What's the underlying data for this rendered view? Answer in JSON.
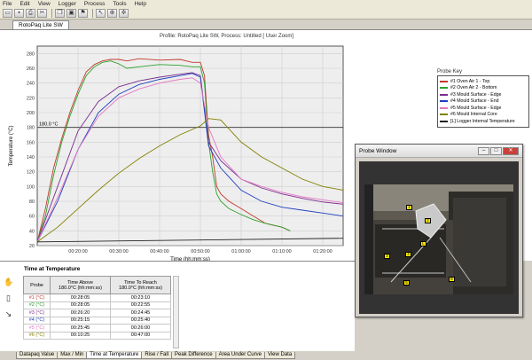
{
  "menu": [
    "File",
    "Edit",
    "View",
    "Logger",
    "Process",
    "Tools",
    "Help"
  ],
  "toolbar_icons": [
    "open-icon",
    "save-icon",
    "print-icon",
    "cut-icon",
    "copy-icon",
    "monitor-icon",
    "flag-icon",
    "cursor-icon",
    "zoom-icon",
    "settings-icon"
  ],
  "document_tab": "RotoPaq Lite SW",
  "chart_title": "Profile: RotoPaq Lite SW, Process: Untitled [ User Zoom]",
  "chart_data": {
    "type": "line",
    "xlabel": "Time (hh:mm:ss)",
    "ylabel": "Temperature (°C)",
    "x_ticks": [
      "00:20:00",
      "00:30:00",
      "00:40:00",
      "00:50:00",
      "01:00:00",
      "01:10:00",
      "01:20:00"
    ],
    "y_ticks": [
      "20",
      "40",
      "60",
      "80",
      "100",
      "120",
      "140",
      "160",
      "180",
      "200",
      "220",
      "240",
      "260",
      "280"
    ],
    "xlim_minutes": [
      10,
      85
    ],
    "ylim": [
      20,
      290
    ],
    "reference_line": {
      "label": "180.0 °C",
      "value": 180
    },
    "series": [
      {
        "name": "#1 Oven Air 1 - Top",
        "color": "#c0392b",
        "x": [
          10,
          12,
          14,
          16,
          18,
          20,
          22,
          24,
          26,
          28,
          30,
          32,
          35,
          40,
          45,
          48,
          50,
          51,
          52,
          53,
          54,
          55,
          57,
          60,
          63,
          66,
          70,
          72
        ],
        "y": [
          25,
          70,
          125,
          165,
          200,
          230,
          255,
          265,
          270,
          272,
          272,
          270,
          273,
          271,
          272,
          268,
          268,
          250,
          170,
          140,
          100,
          90,
          80,
          70,
          60,
          50,
          45,
          40
        ]
      },
      {
        "name": "#2 Oven Air 2 - Bottom",
        "color": "#2ca02c",
        "x": [
          10,
          12,
          14,
          16,
          18,
          20,
          22,
          24,
          26,
          28,
          30,
          32,
          35,
          40,
          45,
          48,
          50,
          51,
          52,
          53,
          54,
          55,
          57,
          60,
          63,
          66,
          70,
          72
        ],
        "y": [
          25,
          60,
          115,
          160,
          195,
          225,
          250,
          262,
          268,
          270,
          266,
          260,
          262,
          265,
          264,
          262,
          262,
          240,
          160,
          120,
          90,
          80,
          70,
          62,
          55,
          50,
          45,
          40
        ]
      },
      {
        "name": "#3 Mould Surface - Edge",
        "color": "#7b2d8e",
        "x": [
          10,
          15,
          20,
          25,
          30,
          35,
          40,
          45,
          48,
          50,
          52,
          55,
          60,
          65,
          70,
          75,
          80,
          85
        ],
        "y": [
          25,
          100,
          175,
          215,
          235,
          243,
          248,
          252,
          254,
          250,
          160,
          135,
          110,
          98,
          90,
          84,
          79,
          76
        ]
      },
      {
        "name": "#4 Mould Surface - End",
        "color": "#1f3fbf",
        "x": [
          10,
          15,
          20,
          25,
          30,
          35,
          40,
          45,
          48,
          50,
          52,
          55,
          60,
          65,
          70,
          75,
          80,
          85
        ],
        "y": [
          25,
          80,
          150,
          200,
          225,
          238,
          245,
          250,
          253,
          248,
          155,
          125,
          95,
          80,
          72,
          68,
          64,
          60
        ]
      },
      {
        "name": "#5 Mould Surface - Edge",
        "color": "#e377c2",
        "x": [
          10,
          15,
          20,
          25,
          30,
          35,
          40,
          45,
          48,
          50,
          52,
          55,
          60,
          65,
          70,
          75,
          80,
          85
        ],
        "y": [
          25,
          85,
          150,
          195,
          220,
          232,
          240,
          245,
          247,
          240,
          180,
          140,
          110,
          100,
          92,
          86,
          82,
          78
        ]
      },
      {
        "name": "#6 Mould Internal Core",
        "color": "#808000",
        "x": [
          10,
          15,
          20,
          25,
          30,
          35,
          40,
          45,
          50,
          52,
          55,
          58,
          60,
          65,
          70,
          75,
          80,
          85
        ],
        "y": [
          25,
          45,
          70,
          95,
          118,
          138,
          155,
          170,
          182,
          192,
          190,
          172,
          160,
          140,
          125,
          110,
          100,
          95
        ]
      },
      {
        "name": "[L] Logger Internal Temperature",
        "color": "#222222",
        "x": [
          10,
          85
        ],
        "y": [
          25,
          30
        ]
      }
    ]
  },
  "legend_title": "Probe Key",
  "time_at_temp": {
    "title": "Time at Temperature",
    "headers": {
      "probe": "Probe",
      "above": "Time Above\n180.0°C (hh:mm:ss)",
      "reach": "Time To Reach\n180.0°C (hh:mm:ss)"
    },
    "rows": [
      {
        "probe": "#1 (°C)",
        "above": "00:28:05",
        "reach": "00:23:10",
        "color": "#c0392b"
      },
      {
        "probe": "#2 (°C)",
        "above": "00:28:05",
        "reach": "00:22:55",
        "color": "#2ca02c"
      },
      {
        "probe": "#3 (°C)",
        "above": "00:26:20",
        "reach": "00:24:45",
        "color": "#7b2d8e"
      },
      {
        "probe": "#4 (°C)",
        "above": "00:25:15",
        "reach": "00:25:40",
        "color": "#1f3fbf"
      },
      {
        "probe": "#5 (°C)",
        "above": "00:25:45",
        "reach": "00:26:00",
        "color": "#e377c2"
      },
      {
        "probe": "#6 (°C)",
        "above": "00:10:25",
        "reach": "00:47:00",
        "color": "#808000"
      }
    ]
  },
  "side_tools": [
    "hand-icon",
    "document-icon",
    "pointer-icon"
  ],
  "bottom_tabs": [
    "Datapaq Value",
    "Max / Min",
    "Time at Temperature",
    "Rise / Fall",
    "Peak Difference",
    "Area Under Curve",
    "View Data"
  ],
  "active_bottom_tab": "Time at Temperature",
  "probe_window": {
    "title": "Probe Window",
    "buttons": [
      "minimize",
      "maximize",
      "close"
    ],
    "labels": [
      "1",
      "2",
      "3",
      "4",
      "5",
      "6",
      "L"
    ]
  }
}
